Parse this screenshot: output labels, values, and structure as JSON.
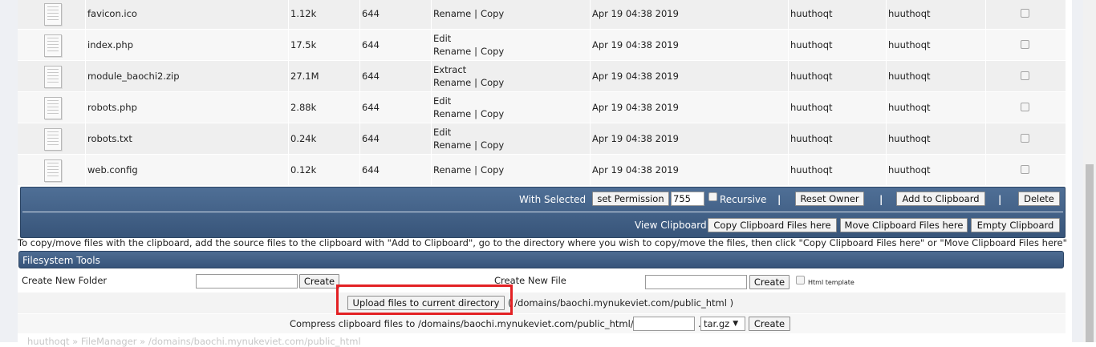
{
  "files": [
    {
      "name": "favicon.ico",
      "size": "1.12k",
      "perm": "644",
      "actions": [
        [
          "Rename",
          "Copy"
        ]
      ],
      "date": "Apr 19 04:38 2019",
      "owner": "huuthoqt",
      "group": "huuthoqt"
    },
    {
      "name": "index.php",
      "size": "17.5k",
      "perm": "644",
      "actions": [
        [
          "Edit"
        ],
        [
          "Rename",
          "Copy"
        ]
      ],
      "date": "Apr 19 04:38 2019",
      "owner": "huuthoqt",
      "group": "huuthoqt"
    },
    {
      "name": "module_baochi2.zip",
      "size": "27.1M",
      "perm": "644",
      "actions": [
        [
          "Extract"
        ],
        [
          "Rename",
          "Copy"
        ]
      ],
      "date": "Apr 19 04:38 2019",
      "owner": "huuthoqt",
      "group": "huuthoqt"
    },
    {
      "name": "robots.php",
      "size": "2.88k",
      "perm": "644",
      "actions": [
        [
          "Edit"
        ],
        [
          "Rename",
          "Copy"
        ]
      ],
      "date": "Apr 19 04:38 2019",
      "owner": "huuthoqt",
      "group": "huuthoqt"
    },
    {
      "name": "robots.txt",
      "size": "0.24k",
      "perm": "644",
      "actions": [
        [
          "Edit"
        ],
        [
          "Rename",
          "Copy"
        ]
      ],
      "date": "Apr 19 04:38 2019",
      "owner": "huuthoqt",
      "group": "huuthoqt"
    },
    {
      "name": "web.config",
      "size": "0.12k",
      "perm": "644",
      "actions": [
        [
          "Rename",
          "Copy"
        ]
      ],
      "date": "Apr 19 04:38 2019",
      "owner": "huuthoqt",
      "group": "huuthoqt"
    }
  ],
  "action_separator": "|",
  "toolbar": {
    "with_selected": "With Selected",
    "set_permission": "set Permission",
    "permission_value": "755",
    "recursive": "Recursive",
    "reset_owner": "Reset Owner",
    "add_to_clipboard": "Add to Clipboard",
    "delete": "Delete",
    "view_clipboard": "View Clipboard",
    "copy_here": "Copy Clipboard Files here",
    "move_here": "Move Clipboard Files here",
    "empty_clipboard": "Empty Clipboard",
    "pipe": "|"
  },
  "clipboard_note": "To copy/move files with the clipboard, add the source files to the clipboard with \"Add to Clipboard\", go to the directory where you wish to copy/move the files, then click \"Copy Clipboard Files here\" or \"Move Clipboard Files here\"",
  "filesystem_tools": {
    "title": "Filesystem Tools",
    "create_folder_label": "Create New Folder",
    "create_folder_value": "",
    "create_button": "Create",
    "create_file_label": "Create New File",
    "create_file_value": "",
    "html_template": "Html template",
    "upload_button": "Upload files to current directory",
    "upload_path": "( /domains/baochi.mynukeviet.com/public_html )",
    "compress_label": "Compress clipboard files to /domains/baochi.mynukeviet.com/public_html/",
    "compress_value": "",
    "compress_dot": ".",
    "compress_format": "tar.gz",
    "select_arrow": "▼"
  },
  "breadcrumb": "huuthoqt » FileManager » /domains/baochi.mynukeviet.com/public_html"
}
